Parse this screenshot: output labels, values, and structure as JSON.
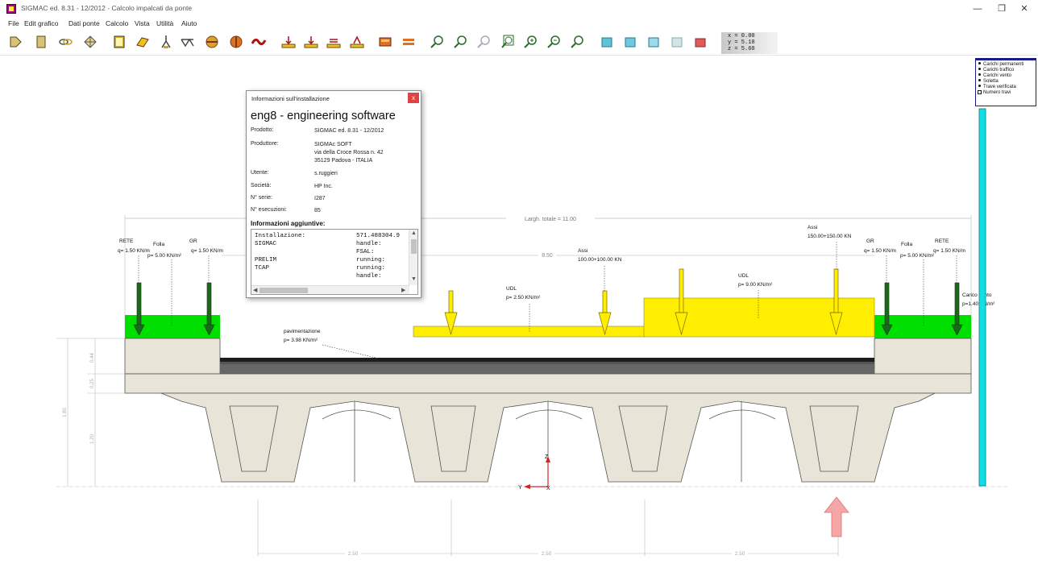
{
  "window": {
    "title": "SIGMAC ed. 8.31 - 12/2012 - Calcolo impalcati da ponte",
    "minimize": "—",
    "maximize": "❐",
    "close": "✕"
  },
  "menu": [
    "File",
    "Edit grafico",
    "Dati ponte",
    "Calcolo",
    "Vista",
    "Utilità",
    "Aiuto"
  ],
  "coords": {
    "x": "x = 0.00",
    "y": "y = 5.10",
    "z": "z = 5.60"
  },
  "legend": {
    "items": [
      "Carichi permanenti",
      "Carichi traffico",
      "Carichi vento",
      "Soletta",
      "Trave verificata"
    ],
    "checkbox_item": "Numero travi"
  },
  "dialog": {
    "title": "Informazioni sull'installazione",
    "close_label": "x",
    "heading": "eng8 - engineering software",
    "fields": [
      {
        "label": "Prodotto:",
        "value": "SIGMAC ed. 8.31 - 12/2012"
      },
      {
        "label": "Produttore:",
        "value": "SIGMAc SOFT"
      },
      {
        "label": "",
        "value": "via della Croce Rossa n. 42"
      },
      {
        "label": "",
        "value": "35129 Padova - ITALIA"
      },
      {
        "label": "Utente:",
        "value": "s.ruggieri"
      },
      {
        "label": "Società:",
        "value": "HP Inc."
      },
      {
        "label": "N° serie:",
        "value": "I287"
      },
      {
        "label": "N° esecuzioni:",
        "value": "85"
      }
    ],
    "info_heading": "Informazioni aggiuntive:",
    "list": [
      {
        "c1": "Installazione:",
        "c2": "571.488304.9"
      },
      {
        "c1": "SIGMAC",
        "c2": "handle:"
      },
      {
        "c1": "",
        "c2": "FSAL:"
      },
      {
        "c1": "PRELIM",
        "c2": "running:"
      },
      {
        "c1": "TCAP",
        "c2": "running:"
      },
      {
        "c1": "",
        "c2": "handle:"
      }
    ]
  },
  "drawing": {
    "total_width_label": "Largh. totale = 11.00",
    "carriageway_label": "8.50",
    "rete_left": "RETE",
    "rete_left_load": "q= 1.50 KN/m",
    "folla_left": "Folla",
    "folla_left_load": "p= 5.00 KN/m²",
    "gr_left": "GR",
    "gr_left_load": "q= 1.50 KN/m",
    "assi1_label": "Assi",
    "assi1_load": "100.00+100.00 KN",
    "assi2_label": "Assi",
    "assi2_load": "150.00+150.00 KN",
    "udl1_label": "UDL",
    "udl1_load": "p= 2.50 KN/m²",
    "udl2_label": "UDL",
    "udl2_load": "p= 9.00 KN/m²",
    "gr_right": "GR",
    "gr_right_load": "q= 1.50 KN/m",
    "folla_right": "Folla",
    "folla_right_load": "p= 5.00 KN/m²",
    "rete_right": "RETE",
    "rete_right_load": "q= 1.50 KN/m",
    "wind_label": "Carico vento",
    "wind_load": "p=1.40 KN/m²",
    "paving_label": "pavimentazione",
    "paving_load": "p= 3.98 KN/m²",
    "dim_044": "0.44",
    "dim_025": "0.25",
    "dim_180": "1.80",
    "dim_120": "1.20",
    "span_1": "2.50",
    "span_2": "2.50",
    "span_3": "2.50",
    "axis_z": "Z",
    "axis_y": "Y",
    "axis_x": "X",
    "colors": {
      "sidewalk_green": "#00e000",
      "load_yellow": "#ffee00",
      "arrow_green": "#1a6a1a",
      "concrete": "#e8e4d8",
      "wind_cyan": "#10e0e6",
      "support_arrow": "#f5a6a6"
    }
  }
}
